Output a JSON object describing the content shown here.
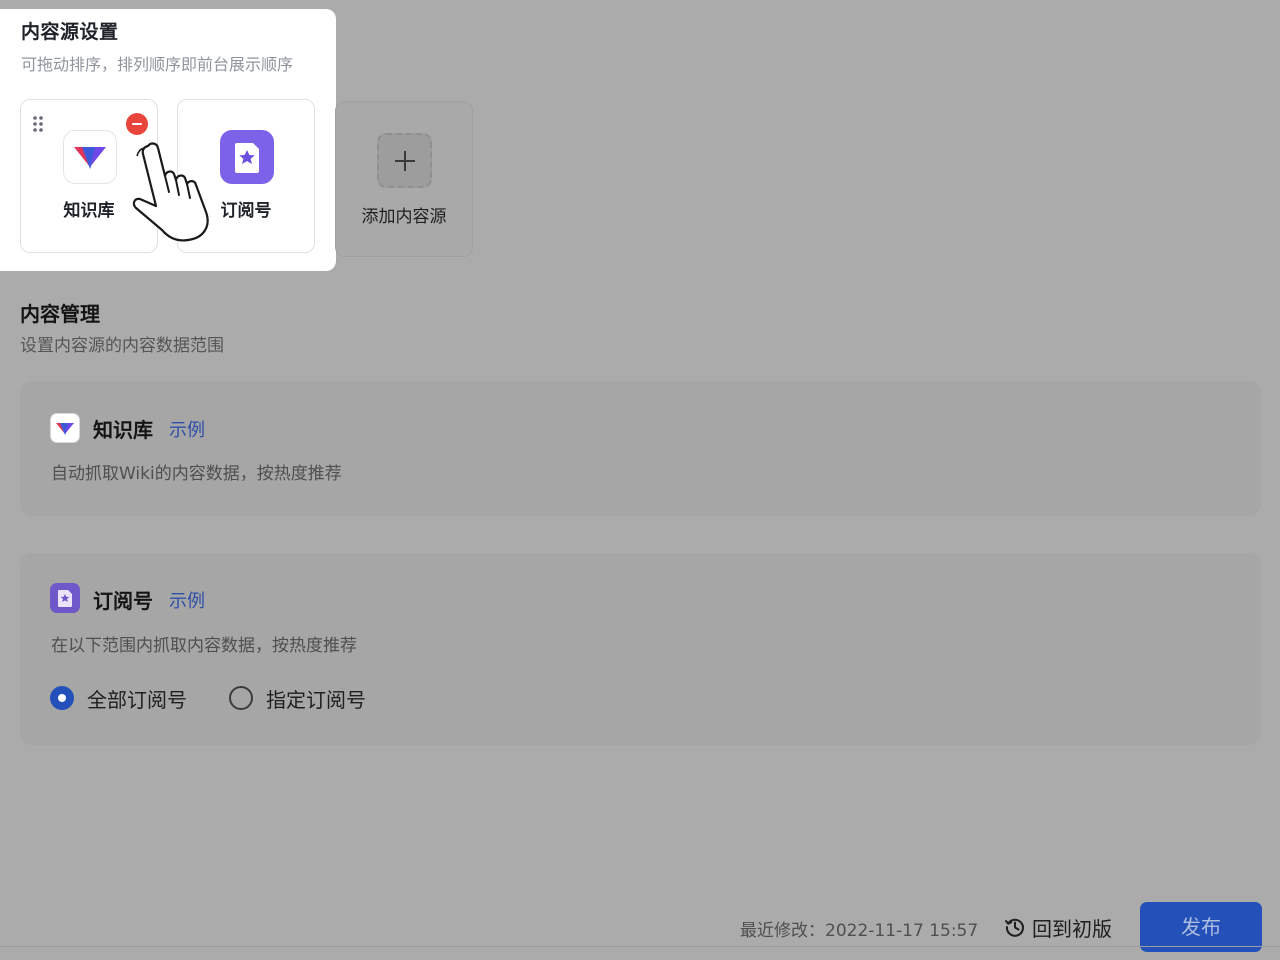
{
  "source_settings": {
    "title": "内容源设置",
    "subtitle": "可拖动排序，排列顺序即前台展示顺序",
    "tiles": [
      {
        "label": "知识库",
        "icon": "knowledge-base-logo-icon"
      },
      {
        "label": "订阅号",
        "icon": "subscription-star-icon"
      }
    ],
    "add_label": "添加内容源"
  },
  "content_mgmt": {
    "title": "内容管理",
    "subtitle": "设置内容源的内容数据范围",
    "cards": [
      {
        "title": "知识库",
        "link": "示例",
        "desc": "自动抓取Wiki的内容数据，按热度推荐"
      },
      {
        "title": "订阅号",
        "link": "示例",
        "desc": "在以下范围内抓取内容数据，按热度推荐",
        "options": [
          {
            "label": "全部订阅号",
            "selected": true
          },
          {
            "label": "指定订阅号",
            "selected": false
          }
        ]
      }
    ]
  },
  "footer": {
    "modified": "最近修改：2022-11-17 15:57",
    "revert_label": "回到初版",
    "publish_label": "发布"
  },
  "colors": {
    "accent": "#2451b9",
    "remove": "#e8453c",
    "overlay": "#ababab",
    "subscription_purple": "#7b62e8"
  }
}
